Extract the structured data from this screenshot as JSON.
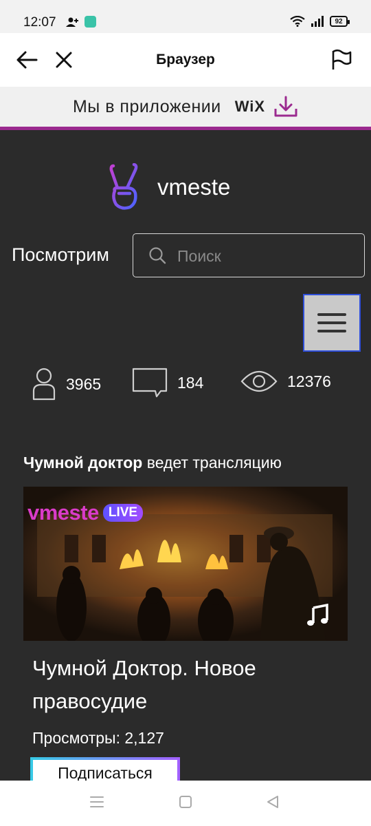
{
  "status_bar": {
    "time": "12:07",
    "battery": "92",
    "icons": [
      "person-add-icon",
      "app-notification-icon",
      "wifi-icon",
      "signal-icon",
      "battery-icon"
    ]
  },
  "browser": {
    "title": "Браузер",
    "back_icon": "arrow-left-icon",
    "close_icon": "close-icon",
    "report_icon": "flag-icon"
  },
  "promo": {
    "text": "Мы в приложении",
    "brand": "WiX",
    "accent": "#9b2a8f"
  },
  "site": {
    "logo_text": "vmeste",
    "watch_label": "Посмотрим",
    "search_placeholder": "Поиск",
    "stats": {
      "users": "3965",
      "comments": "184",
      "views": "12376"
    },
    "stream": {
      "streamer": "Чумной доктор",
      "action": " ведет трансляцию",
      "brand": "vmeste",
      "live_badge": "LIVE",
      "title": "Чумной Доктор. Новое правосудие",
      "views_text": "Просмотры: 2,127",
      "subscribe": "Подписаться"
    },
    "colors": {
      "background": "#2b2b2b",
      "brand_pink": "#d93bc9",
      "live_purple": "#7a4fff",
      "menu_border": "#2f4fdb"
    }
  }
}
